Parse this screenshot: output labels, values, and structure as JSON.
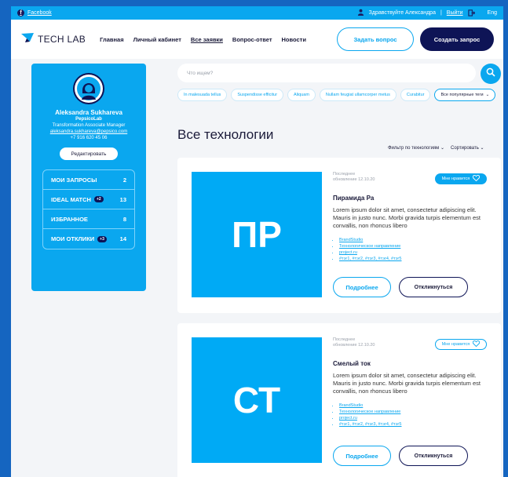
{
  "topbar": {
    "facebook": "Facebook",
    "greeting": "Здравствуйте Александра",
    "logout": "Выйти",
    "lang": "Eng"
  },
  "header": {
    "logo_text": "TECH LAB",
    "nav": [
      "Главная",
      "Личный кабинет",
      "Все заявки",
      "Вопрос-ответ",
      "Новости"
    ],
    "ask_button": "Задать вопрос",
    "create_button": "Создать запрос"
  },
  "profile": {
    "name": "Aleksandra Sukhareva",
    "company": "PepsicoLab",
    "role": "Transformation Associate Manager",
    "email": "aleksandra.sukhareva@pepsico.com",
    "phone": "+7 916 620 45 06",
    "edit_button": "Редактировать",
    "menu": [
      {
        "label": "МОИ ЗАПРОСЫ",
        "badge": "",
        "count": "2"
      },
      {
        "label": "IDEAL MATCH",
        "badge": "+2",
        "count": "13"
      },
      {
        "label": "ИЗБРАННОЕ",
        "badge": "",
        "count": "8"
      },
      {
        "label": "МОИ ОТКЛИКИ",
        "badge": "+3",
        "count": "14"
      }
    ]
  },
  "search": {
    "placeholder": "Что ищем?",
    "chips": [
      "In malesuada tellus",
      "Suspendisse efficitur",
      "Aliquam",
      "Nullam feugiat ullamcorper metus",
      "Curabitur"
    ],
    "popular_chip": "Все популярные теги"
  },
  "main": {
    "title": "Все технологии",
    "filter_label": "Фильтр по технологиям",
    "sort_label": "Сортировать"
  },
  "cards": [
    {
      "tile": "ПР",
      "meta_line1": "Последнее",
      "meta_line2": "обновление 12.10.20",
      "like": "Мне нравится",
      "title": "Пирамида Ра",
      "desc": "Lorem ipsum dolor sit amet, consectetur adipiscing elit. Mauris in justo nunc. Morbi gravida turpis elementum est convallis, non rhoncus libero",
      "links": [
        "BrandStudio",
        "Технологическое направление",
        "project.ru",
        "#тэг1, #тэг2, #тэг3, #тэг4, #тэг5"
      ],
      "more": "Подробнее",
      "reply": "Откликнуться"
    },
    {
      "tile": "СТ",
      "meta_line1": "Последнее",
      "meta_line2": "обновление 12.10.20",
      "like": "Мне нравится",
      "title": "Смелый ток",
      "desc": "Lorem ipsum dolor sit amet, consectetur adipiscing elit. Mauris in justo nunc. Morbi gravida turpis elementum est convallis, non rhoncus libero",
      "links": [
        "BrandStudio",
        "Технологическое направление",
        "project.ru",
        "#тэг1, #тэг2, #тэг3, #тэг4, #тэг5"
      ],
      "more": "Подробнее",
      "reply": "Откликнуться"
    }
  ]
}
